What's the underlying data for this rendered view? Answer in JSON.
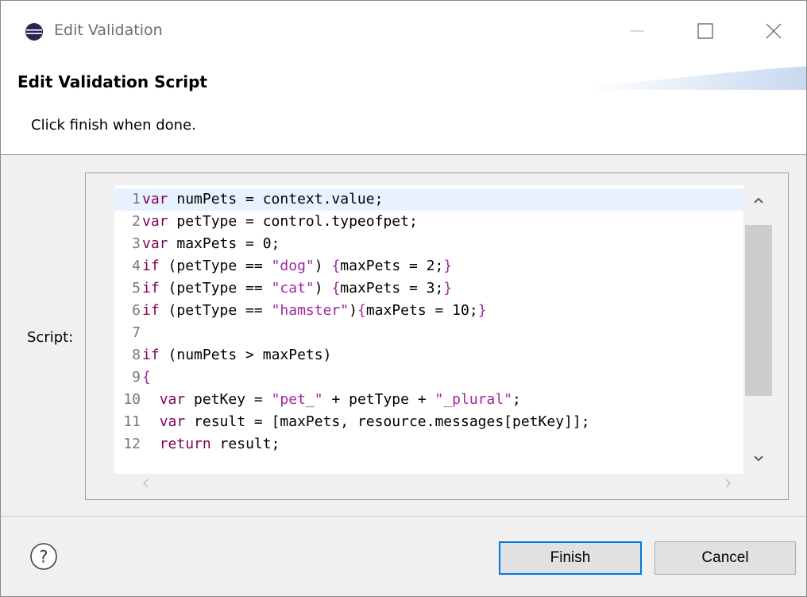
{
  "window": {
    "title": "Edit Validation",
    "icons": {
      "app": "eclipse-icon",
      "minimize": "minimize-icon",
      "maximize": "maximize-icon",
      "close": "close-icon"
    }
  },
  "header": {
    "title": "Edit Validation Script",
    "message": "Click finish when done."
  },
  "editor": {
    "label": "Script:",
    "current_line": 1,
    "lines": [
      {
        "num": "1",
        "tokens": [
          {
            "t": "var",
            "c": "kw"
          },
          {
            "t": " numPets = context.value;",
            "c": ""
          }
        ]
      },
      {
        "num": "2",
        "tokens": [
          {
            "t": "var",
            "c": "kw"
          },
          {
            "t": " petType = control.typeofpet;",
            "c": ""
          }
        ]
      },
      {
        "num": "3",
        "tokens": [
          {
            "t": "var",
            "c": "kw"
          },
          {
            "t": " maxPets = 0;",
            "c": ""
          }
        ]
      },
      {
        "num": "4",
        "tokens": [
          {
            "t": "if",
            "c": "kw"
          },
          {
            "t": " (petType == ",
            "c": ""
          },
          {
            "t": "\"dog\"",
            "c": "str"
          },
          {
            "t": ") ",
            "c": ""
          },
          {
            "t": "{",
            "c": "brace"
          },
          {
            "t": "maxPets = 2;",
            "c": ""
          },
          {
            "t": "}",
            "c": "brace"
          }
        ]
      },
      {
        "num": "5",
        "tokens": [
          {
            "t": "if",
            "c": "kw"
          },
          {
            "t": " (petType == ",
            "c": ""
          },
          {
            "t": "\"cat\"",
            "c": "str"
          },
          {
            "t": ") ",
            "c": ""
          },
          {
            "t": "{",
            "c": "brace"
          },
          {
            "t": "maxPets = 3;",
            "c": ""
          },
          {
            "t": "}",
            "c": "brace"
          }
        ]
      },
      {
        "num": "6",
        "tokens": [
          {
            "t": "if",
            "c": "kw"
          },
          {
            "t": " (petType == ",
            "c": ""
          },
          {
            "t": "\"hamster\"",
            "c": "str"
          },
          {
            "t": ")",
            "c": ""
          },
          {
            "t": "{",
            "c": "brace"
          },
          {
            "t": "maxPets = 10;",
            "c": ""
          },
          {
            "t": "}",
            "c": "brace"
          }
        ]
      },
      {
        "num": "7",
        "tokens": []
      },
      {
        "num": "8",
        "tokens": [
          {
            "t": "if",
            "c": "kw"
          },
          {
            "t": " (numPets > maxPets)",
            "c": ""
          }
        ]
      },
      {
        "num": "9",
        "tokens": [
          {
            "t": "{",
            "c": "brace"
          }
        ]
      },
      {
        "num": "10",
        "tokens": [
          {
            "t": "  ",
            "c": ""
          },
          {
            "t": "var",
            "c": "kw"
          },
          {
            "t": " petKey = ",
            "c": ""
          },
          {
            "t": "\"pet_\"",
            "c": "str"
          },
          {
            "t": " + petType + ",
            "c": ""
          },
          {
            "t": "\"_plural\"",
            "c": "str"
          },
          {
            "t": ";",
            "c": ""
          }
        ]
      },
      {
        "num": "11",
        "tokens": [
          {
            "t": "  ",
            "c": ""
          },
          {
            "t": "var",
            "c": "kw"
          },
          {
            "t": " result = [maxPets, resource.messages[petKey]];",
            "c": ""
          }
        ]
      },
      {
        "num": "12",
        "tokens": [
          {
            "t": "  ",
            "c": ""
          },
          {
            "t": "return",
            "c": "kw"
          },
          {
            "t": " result;",
            "c": ""
          }
        ]
      }
    ],
    "icons": {
      "scroll_up": "chevron-up-icon",
      "scroll_down": "chevron-down-icon",
      "scroll_left": "chevron-left-icon",
      "scroll_right": "chevron-right-icon"
    }
  },
  "footer": {
    "help_icon": "help-icon",
    "finish_label": "Finish",
    "cancel_label": "Cancel"
  },
  "colors": {
    "keyword": "#7f0055",
    "string": "#a126a1",
    "current_line": "#e8f2fe",
    "default_button_border": "#0078d7"
  }
}
